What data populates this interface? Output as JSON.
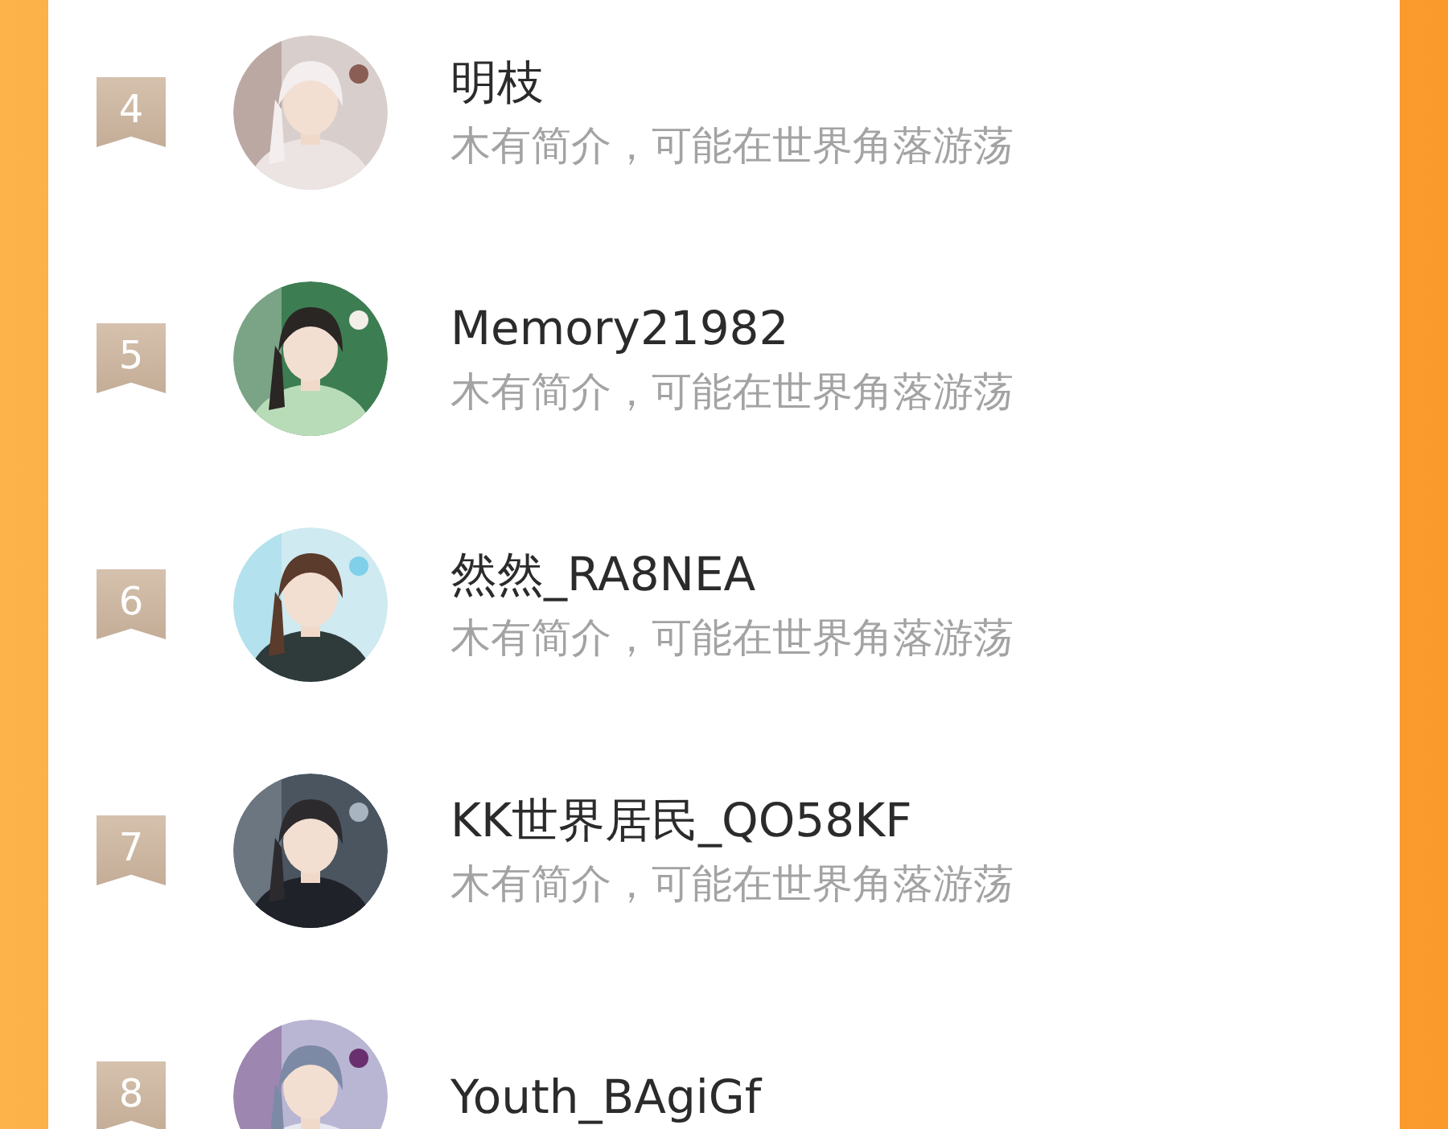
{
  "ranking": [
    {
      "rank": "4",
      "name": "明枝",
      "bio": "木有简介，可能在世界角落游荡"
    },
    {
      "rank": "5",
      "name": "Memory21982",
      "bio": "木有简介，可能在世界角落游荡"
    },
    {
      "rank": "6",
      "name": "然然_RA8NEA",
      "bio": "木有简介，可能在世界角落游荡"
    },
    {
      "rank": "7",
      "name": "KK世界居民_QO58KF",
      "bio": "木有简介，可能在世界角落游荡"
    },
    {
      "rank": "8",
      "name": "Youth_BAgiGf"
    }
  ]
}
